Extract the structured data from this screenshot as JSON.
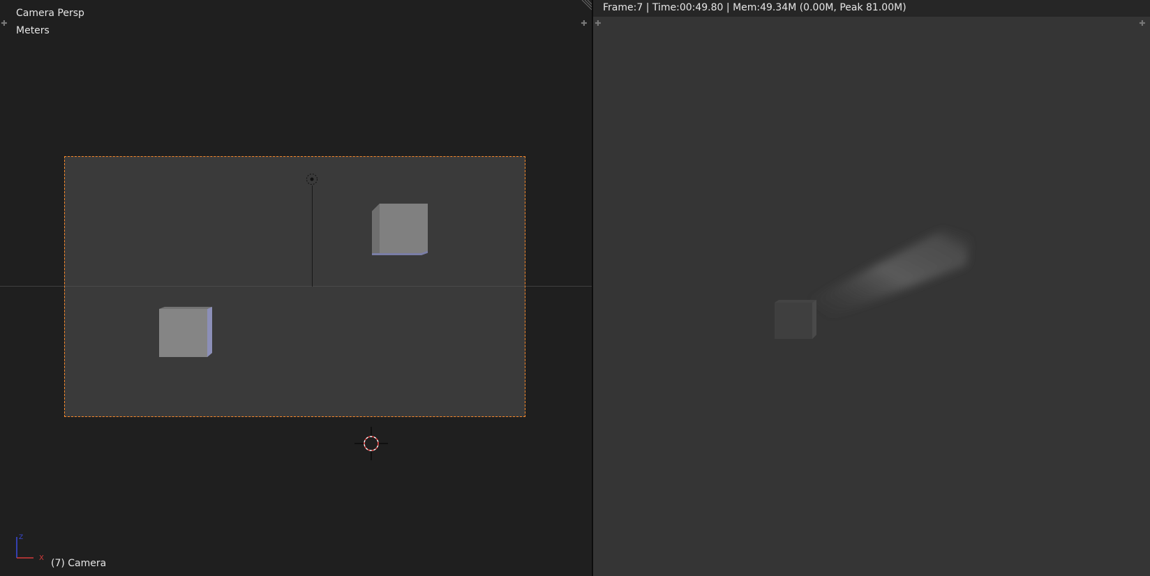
{
  "viewport_3d": {
    "view_name": "Camera Persp",
    "units": "Meters",
    "object_info": "(7) Camera",
    "axis_labels": {
      "x": "X",
      "z": "Z"
    }
  },
  "render_view": {
    "status": "Frame:7 | Time:00:49.80 | Mem:49.34M (0.00M, Peak 81.00M)"
  },
  "colors": {
    "viewport_bg": "#1f1f1f",
    "camera_frame_border": "#ff8a2a",
    "render_bg": "#353535",
    "axis_x": "#d63a3a",
    "axis_z": "#3a4ad6"
  },
  "icons": {
    "corner_left": "plus-icon",
    "corner_right": "plus-icon",
    "lamp": "lamp-icon",
    "cursor": "3d-cursor-icon",
    "gizmo": "axis-gizmo-icon"
  }
}
